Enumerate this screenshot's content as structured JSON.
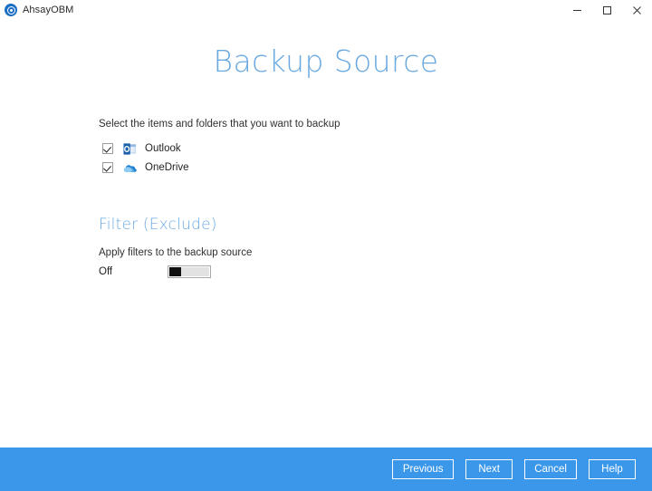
{
  "window": {
    "app_title": "AhsayOBM",
    "app_icon": "ahsay-circle-icon",
    "controls": [
      {
        "name": "minimize-button",
        "glyph": "minimize-icon"
      },
      {
        "name": "maximize-button",
        "glyph": "maximize-icon"
      },
      {
        "name": "close-button",
        "glyph": "close-icon"
      }
    ]
  },
  "page": {
    "title": "Backup Source",
    "title_color": "#6aa9e0"
  },
  "backup_source": {
    "instruction": "Select the items and folders that you want to backup",
    "items": [
      {
        "label": "Outlook",
        "checked": true,
        "icon": "outlook-icon"
      },
      {
        "label": "OneDrive",
        "checked": true,
        "icon": "onedrive-icon"
      }
    ]
  },
  "filter": {
    "section_title": "Filter (Exclude)",
    "description": "Apply filters to the backup source",
    "toggle_label": "Off",
    "toggle_state": "off"
  },
  "footer": {
    "background": "#3b97ea",
    "buttons": [
      {
        "label": "Previous",
        "name": "previous-button"
      },
      {
        "label": "Next",
        "name": "next-button"
      },
      {
        "label": "Cancel",
        "name": "cancel-button"
      },
      {
        "label": "Help",
        "name": "help-button"
      }
    ]
  }
}
